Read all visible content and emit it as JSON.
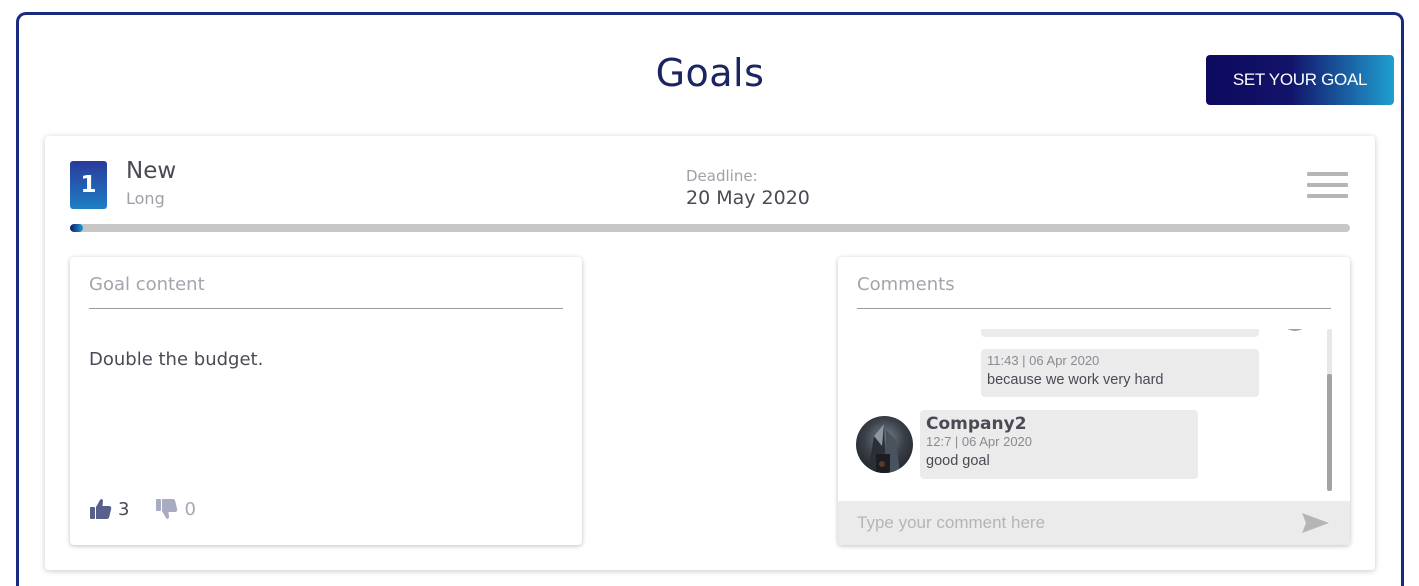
{
  "page": {
    "title": "Goals",
    "set_goal_button": "SET YOUR GOAL"
  },
  "goal": {
    "number": "1",
    "title": "New",
    "subtitle": "Long",
    "deadline_label": "Deadline:",
    "deadline_value": "20 May 2020",
    "progress_fraction": 0.01,
    "content_header": "Goal content",
    "content_text": "Double the budget.",
    "likes": "3",
    "dislikes": "0"
  },
  "comments": {
    "header": "Comments",
    "items": [
      {
        "time": "11:43 | 06 Apr 2020",
        "text": "because we work very hard"
      },
      {
        "author": "Company2",
        "time": "12:7 | 06 Apr 2020",
        "text": "good goal"
      }
    ],
    "input_placeholder": "Type your comment here"
  },
  "icons": [
    "menu-icon",
    "thumbs-up-icon",
    "thumbs-down-icon",
    "send-icon",
    "avatar"
  ],
  "colors": {
    "brand_dark": "#12136a",
    "brand_light": "#1f9fd0",
    "frame_border": "#1a2a80"
  }
}
